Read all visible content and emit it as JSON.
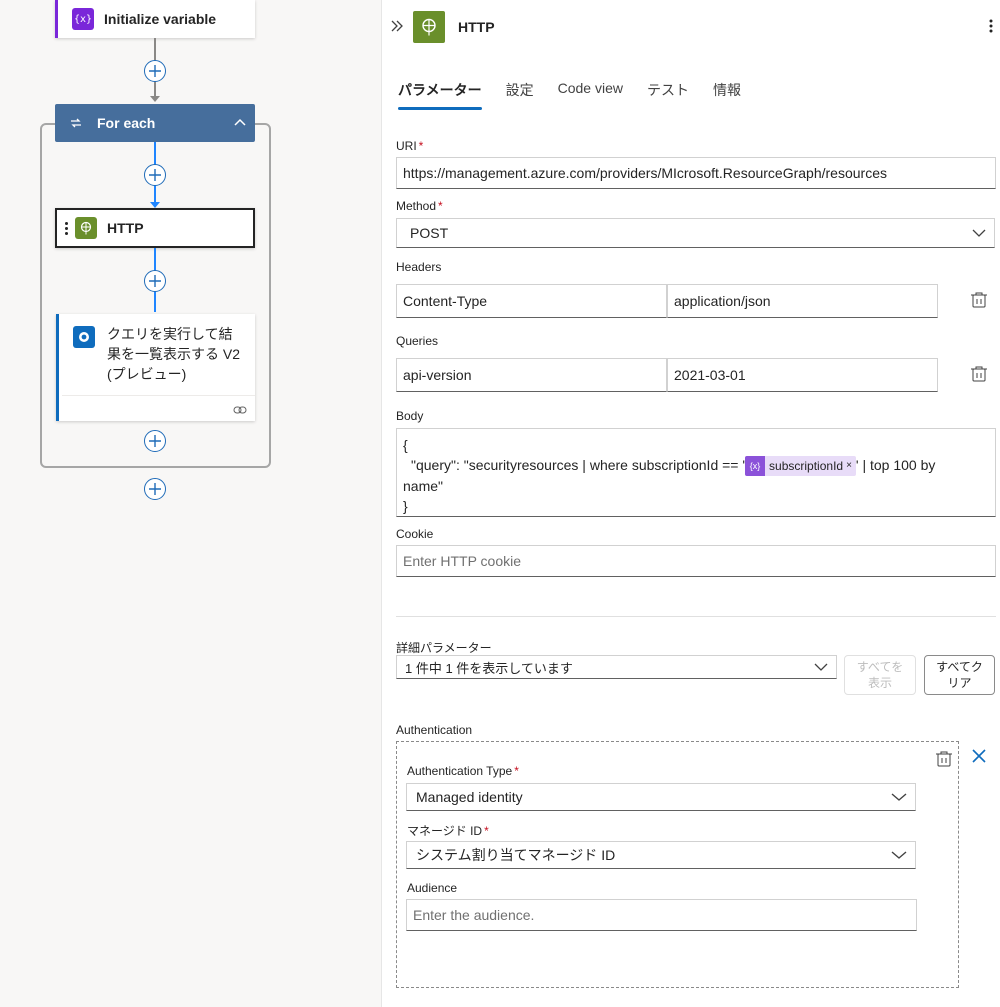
{
  "canvas": {
    "init_variable": {
      "title": "Initialize variable",
      "icon": "variable-icon",
      "icon_glyph": "{x}"
    },
    "foreach": {
      "title": "For each"
    },
    "http_action": {
      "title": "HTTP"
    },
    "query_action": {
      "title": "クエリを実行して結果を一覧表示する V2 (プレビュー)"
    }
  },
  "panel": {
    "title": "HTTP",
    "tabs": [
      {
        "label": "パラメーター",
        "active": true
      },
      {
        "label": "設定",
        "active": false
      },
      {
        "label": "Code view",
        "active": false
      },
      {
        "label": "テスト",
        "active": false
      },
      {
        "label": "情報",
        "active": false
      }
    ],
    "uri": {
      "label": "URI",
      "required_mark": "*",
      "value": "https://management.azure.com/providers/MIcrosoft.ResourceGraph/resources"
    },
    "method": {
      "label": "Method",
      "required_mark": "*",
      "value": "POST"
    },
    "headers": {
      "label": "Headers",
      "key": "Content-Type",
      "value": "application/json"
    },
    "queries": {
      "label": "Queries",
      "key": "api-version",
      "value": "2021-03-01"
    },
    "body": {
      "label": "Body",
      "line1": "{",
      "line2_prefix": "\"query\": \"securityresources | where subscriptionId == '",
      "token_label": "subscriptionId",
      "token_icon_glyph": "{x}",
      "token_close": "×",
      "line2_suffix": "' | top 100 by",
      "line3": "name\"",
      "line4": "}"
    },
    "cookie": {
      "label": "Cookie",
      "placeholder": "Enter HTTP cookie"
    },
    "advanced": {
      "label": "詳細パラメーター",
      "summary": "1 件中 1 件を表示しています",
      "show_all_line1": "すべてを",
      "show_all_line2": "表示",
      "clear_all_line1": "すべてク",
      "clear_all_line2": "リア"
    },
    "authentication": {
      "label": "Authentication",
      "type_label": "Authentication Type",
      "type_value": "Managed identity",
      "identity_label": "マネージド ID",
      "identity_value": "システム割り当てマネージド ID",
      "audience_label": "Audience",
      "audience_placeholder": "Enter the audience.",
      "required_mark": "*"
    }
  },
  "colors": {
    "accent": "#0f6cbd",
    "foreach_header": "#466e9c",
    "variable_purple": "#7a27d9",
    "http_green": "#6a8f2b",
    "connector_blue": "#1f85ff"
  }
}
